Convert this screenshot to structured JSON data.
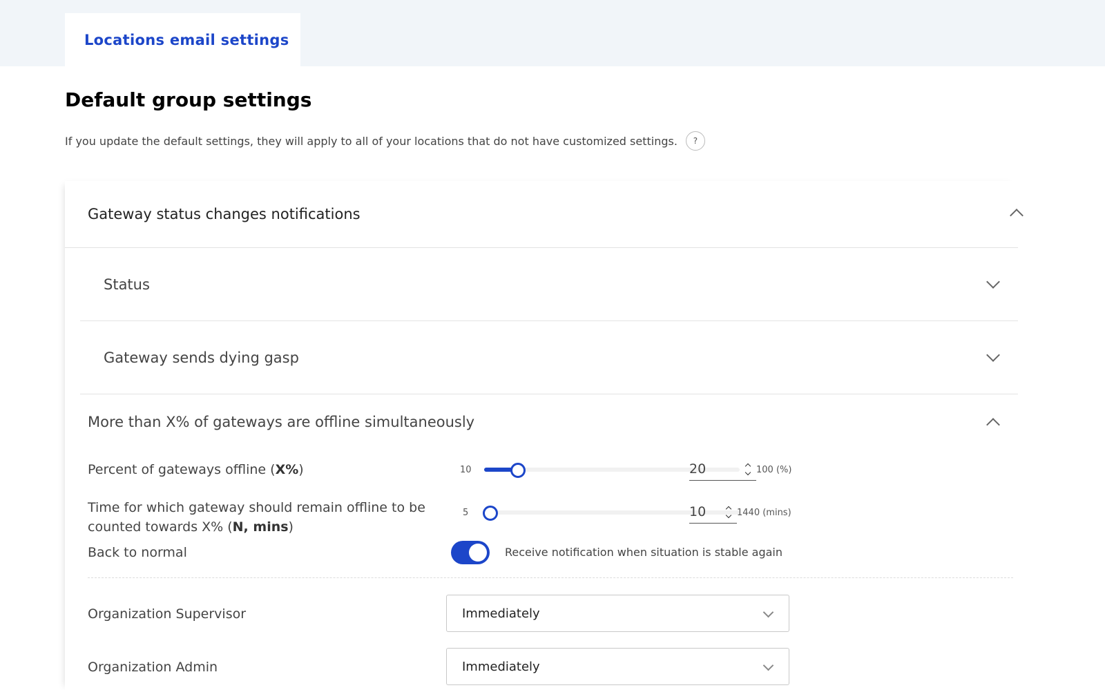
{
  "tabs": [
    {
      "label": "Locations email settings"
    }
  ],
  "page": {
    "title": "Default group settings",
    "description": "If you update the default settings, they will apply to all of your locations that do not have customized settings.",
    "help_glyph": "?"
  },
  "sections": {
    "gateway": {
      "title": "Gateway status changes notifications",
      "expanded": true
    },
    "status": {
      "title": "Status",
      "expanded": false
    },
    "dying_gasp": {
      "title": "Gateway sends dying gasp",
      "expanded": false
    },
    "offline": {
      "title": "More than X% of gateways are offline simultaneously",
      "expanded": true
    }
  },
  "percent_offline": {
    "label_prefix": "Percent of gateways offline (",
    "label_bold": "X%",
    "label_suffix": ")",
    "min": "10",
    "max_label": "100 (%)",
    "value": "20",
    "min_value": 10,
    "max_value": 100
  },
  "time_offline": {
    "label_prefix": "Time for which gateway should remain offline to be counted towards X% (",
    "label_bold": "N, mins",
    "label_suffix": ")",
    "min": "5",
    "max_label": "1440 (mins)",
    "value": "10",
    "min_value": 5,
    "max_value": 1440
  },
  "back_to_normal": {
    "label": "Back to normal",
    "enabled": true,
    "text": "Receive notification when situation is stable again"
  },
  "roles": [
    {
      "label": "Organization Supervisor",
      "value": "Immediately"
    },
    {
      "label": "Organization Admin",
      "value": "Immediately"
    }
  ],
  "colors": {
    "accent": "#1c46c9",
    "topbar": "#f1f5f9"
  }
}
